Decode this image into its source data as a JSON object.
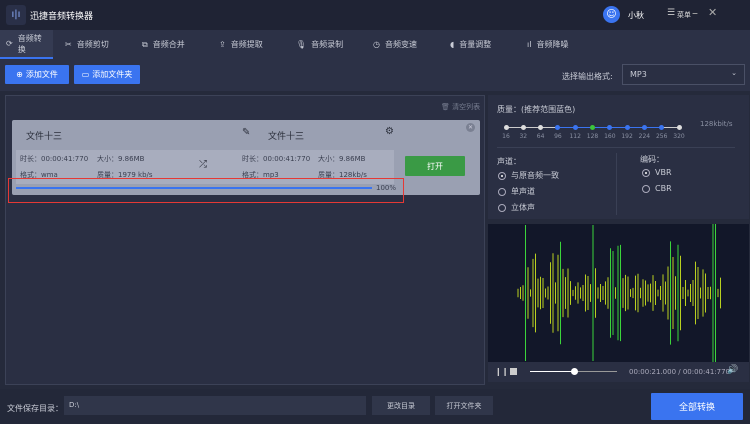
{
  "app": {
    "title": "迅捷音频转换器",
    "user": "小秋",
    "menu": "菜单"
  },
  "tabs": [
    {
      "label": "音频转换",
      "icon": "refresh-icon"
    },
    {
      "label": "音频剪切",
      "icon": "scissors-icon"
    },
    {
      "label": "音频合并",
      "icon": "merge-icon"
    },
    {
      "label": "音频提取",
      "icon": "upload-icon"
    },
    {
      "label": "音频录制",
      "icon": "mic-icon"
    },
    {
      "label": "音频变速",
      "icon": "speed-icon"
    },
    {
      "label": "音量调整",
      "icon": "volume-icon"
    },
    {
      "label": "音频降噪",
      "icon": "denoise-icon"
    }
  ],
  "toolbar": {
    "add_file": "添加文件",
    "add_folder": "添加文件夹",
    "format_label": "选择输出格式:",
    "format_value": "MP3"
  },
  "list": {
    "clear": "清空列表"
  },
  "file": {
    "src_name": "文件十三",
    "dst_name": "文件十三",
    "src": {
      "duration": "时长：00:00:41:770",
      "size": "大小：9.86MB",
      "format": "格式：wma",
      "quality": "质量：1979 kb/s"
    },
    "dst": {
      "duration": "时长：00:00:41:770",
      "size": "大小：9.86MB",
      "format": "格式：mp3",
      "quality": "质量：128kb/s"
    },
    "open": "打开",
    "progress": 100,
    "progress_label": "100%"
  },
  "settings": {
    "quality_label": "质量：(推荐范围蓝色)",
    "bitrates": [
      "16",
      "32",
      "64",
      "96",
      "112",
      "128",
      "160",
      "192",
      "224",
      "256",
      "320"
    ],
    "selected": "128",
    "recommended": [
      "96",
      "112",
      "128",
      "160",
      "192",
      "224",
      "256"
    ],
    "current": "128kbit/s",
    "channel_label": "声道：",
    "channels": [
      {
        "label": "与原音频一致",
        "on": true
      },
      {
        "label": "单声道",
        "on": false
      },
      {
        "label": "立体声",
        "on": false
      }
    ],
    "encoding_label": "编码：",
    "encodings": [
      {
        "label": "VBR",
        "on": true
      },
      {
        "label": "CBR",
        "on": false
      }
    ]
  },
  "player": {
    "time": "00:00:21.000 / 00:00:41:770",
    "position": 0.5
  },
  "bottom": {
    "save_label": "文件保存目录：",
    "path": "D:\\",
    "change": "更改目录",
    "open_folder": "打开文件夹",
    "convert_all": "全部转换"
  },
  "colors": {
    "accent": "#3a74f0",
    "green": "#3a9a45",
    "wave": "#7fd020"
  }
}
